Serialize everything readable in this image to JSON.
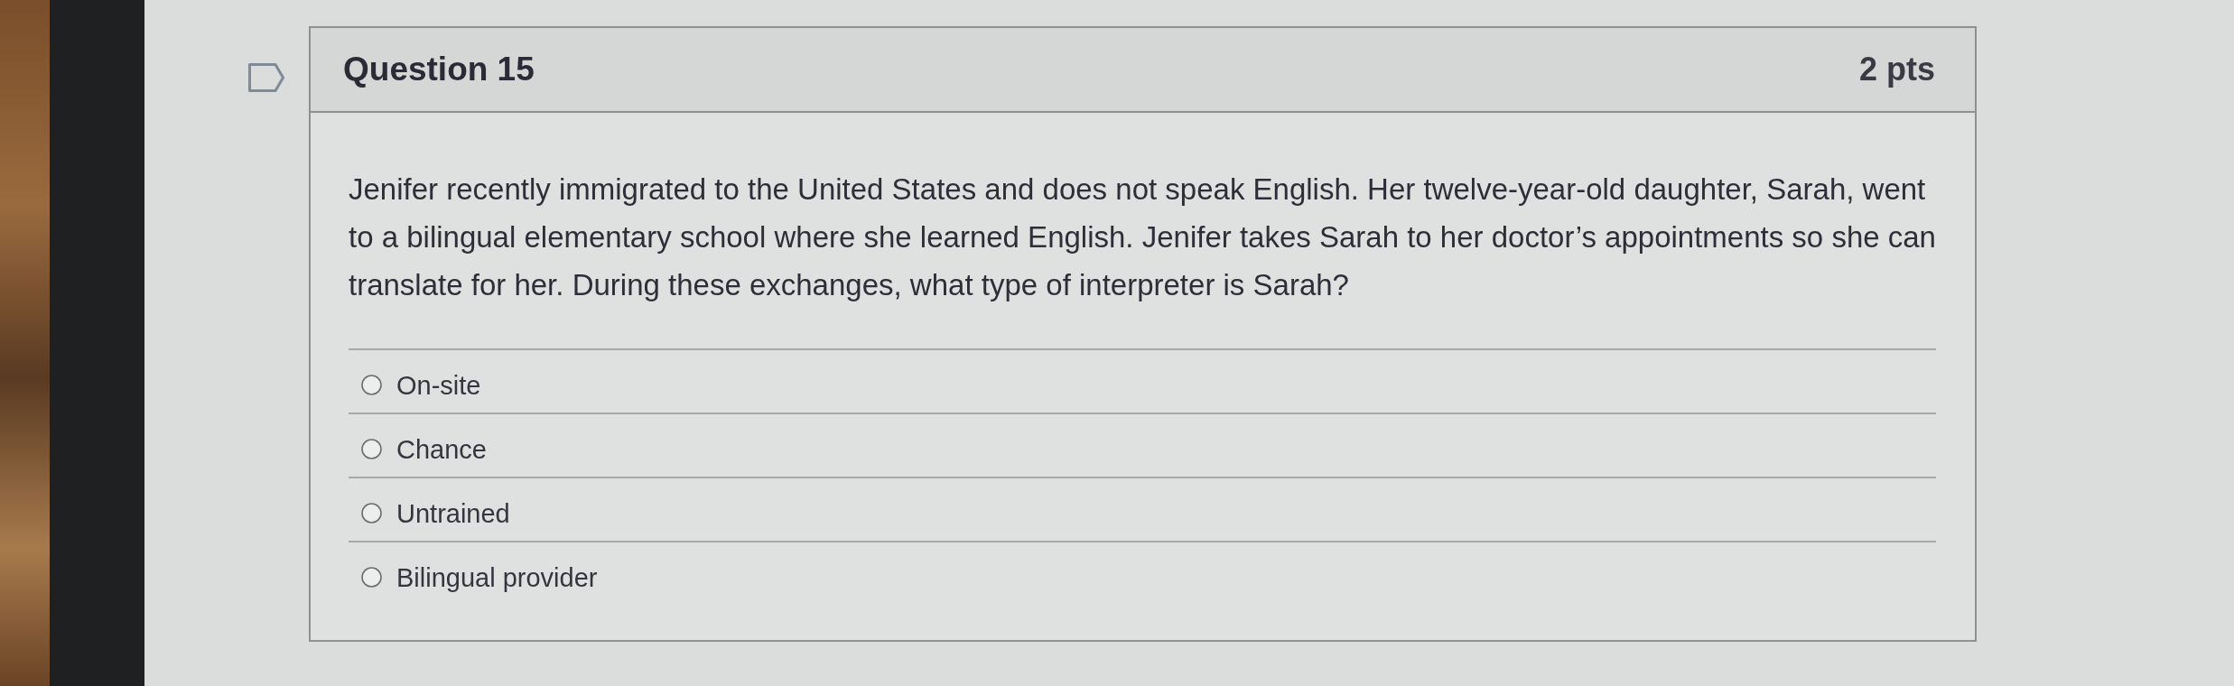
{
  "question": {
    "title": "Question 15",
    "points": "2 pts",
    "flagged": false,
    "text": "Jenifer recently immigrated to the United States and does not speak English. Her twelve-year-old daughter, Sarah, went to a bilingual elementary school where she learned English. Jenifer takes Sarah to her doctor’s appointments so she can translate for her. During these exchanges, what type of interpreter is Sarah?",
    "answers": [
      {
        "label": "On-site",
        "selected": false
      },
      {
        "label": "Chance",
        "selected": false
      },
      {
        "label": "Untrained",
        "selected": false
      },
      {
        "label": "Bilingual provider",
        "selected": false
      }
    ]
  }
}
